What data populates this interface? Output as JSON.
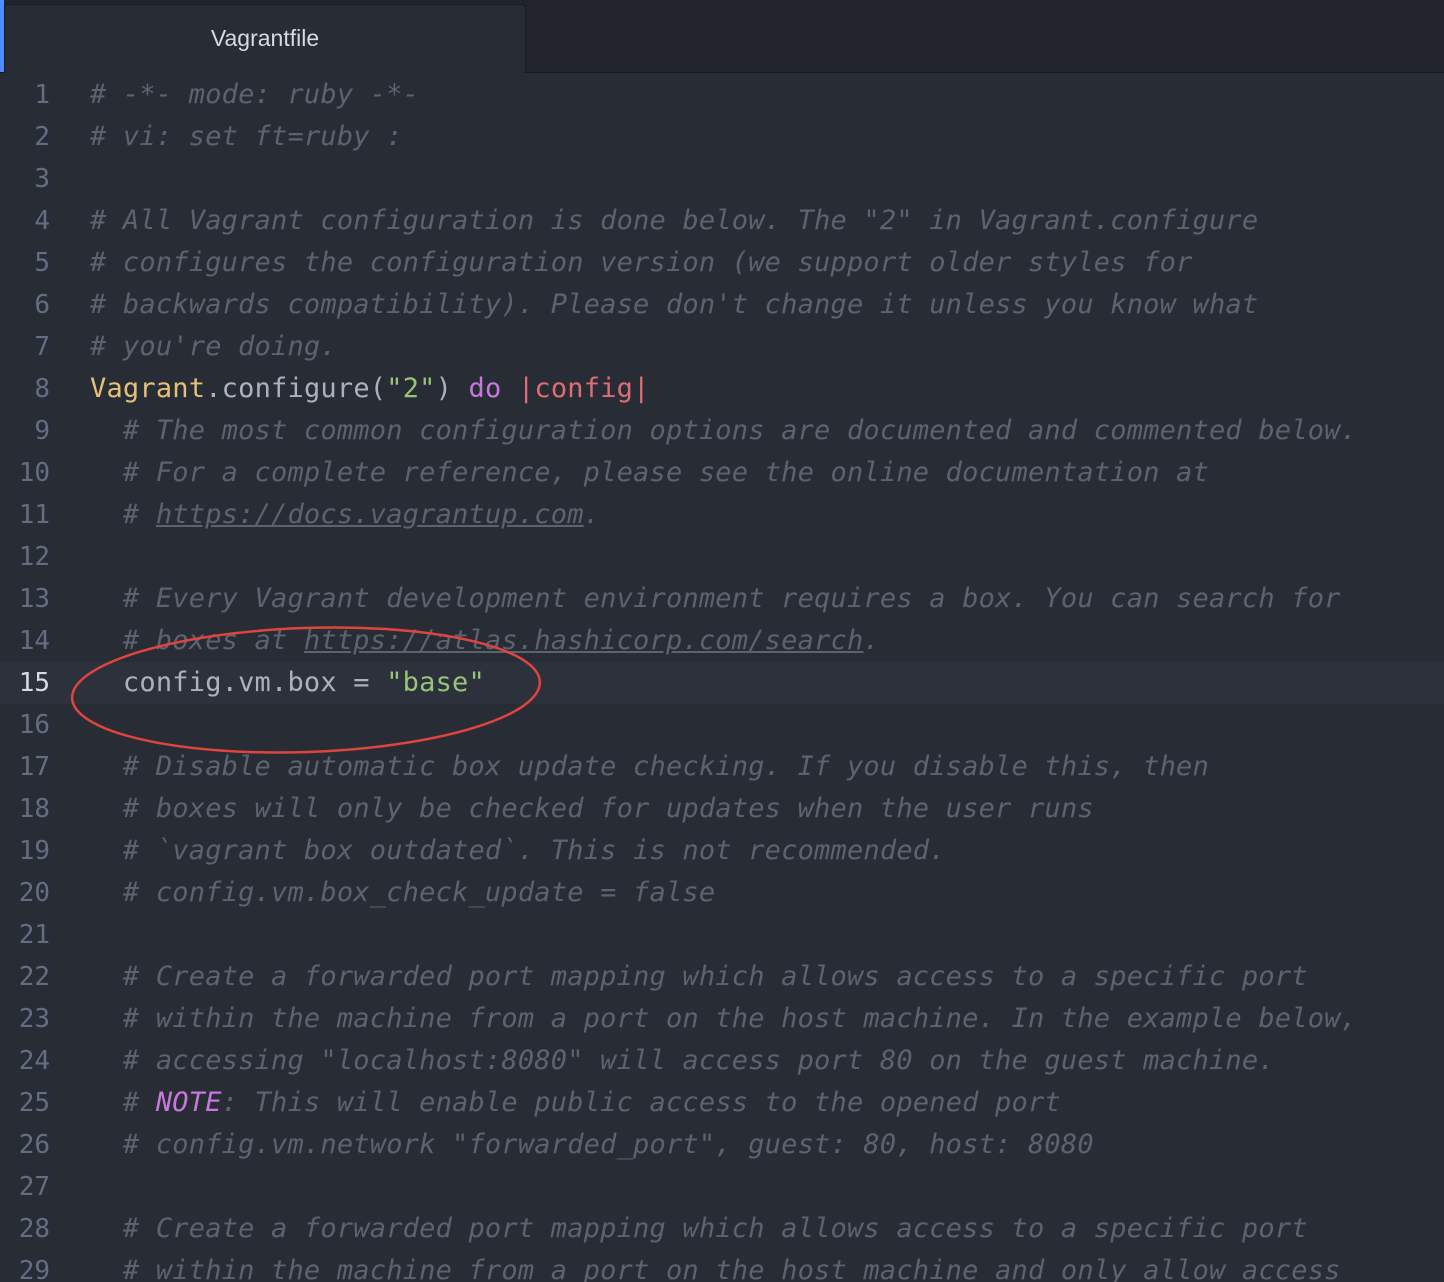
{
  "tab": {
    "title": "Vagrantfile"
  },
  "editor": {
    "cursor_line": "15",
    "lines": [
      {
        "n": "1",
        "comment": "# -*- mode: ruby -*-"
      },
      {
        "n": "2",
        "comment": "# vi: set ft=ruby :"
      },
      {
        "n": "3"
      },
      {
        "n": "4",
        "comment": "# All Vagrant configuration is done below. The \"2\" in Vagrant.configure"
      },
      {
        "n": "5",
        "comment": "# configures the configuration version (we support older styles for"
      },
      {
        "n": "6",
        "comment": "# backwards compatibility). Please don't change it unless you know what"
      },
      {
        "n": "7",
        "comment": "# you're doing."
      },
      {
        "n": "8",
        "cls": "Vagrant",
        "dot": ".",
        "method": "configure(",
        "str": "\"2\"",
        "close": ")",
        "space": " ",
        "kw": "do",
        "space2": " ",
        "var": "|config|"
      },
      {
        "n": "9",
        "comment": "  # The most common configuration options are documented and commented below."
      },
      {
        "n": "10",
        "comment": "  # For a complete reference, please see the online documentation at"
      },
      {
        "n": "11",
        "prefix": "  # ",
        "link": "https://docs.vagrantup.com",
        "suffix": "."
      },
      {
        "n": "12"
      },
      {
        "n": "13",
        "comment": "  # Every Vagrant development environment requires a box. You can search for"
      },
      {
        "n": "14",
        "prefix": "  # boxes at ",
        "link": "https://atlas.hashicorp.com/search",
        "suffix": "."
      },
      {
        "n": "15",
        "code": "  config.vm.box = ",
        "str": "\"base\""
      },
      {
        "n": "16"
      },
      {
        "n": "17",
        "comment": "  # Disable automatic box update checking. If you disable this, then"
      },
      {
        "n": "18",
        "comment": "  # boxes will only be checked for updates when the user runs"
      },
      {
        "n": "19",
        "comment": "  # `vagrant box outdated`. This is not recommended."
      },
      {
        "n": "20",
        "comment": "  # config.vm.box_check_update = false"
      },
      {
        "n": "21"
      },
      {
        "n": "22",
        "comment": "  # Create a forwarded port mapping which allows access to a specific port"
      },
      {
        "n": "23",
        "comment": "  # within the machine from a port on the host machine. In the example below,"
      },
      {
        "n": "24",
        "comment": "  # accessing \"localhost:8080\" will access port 80 on the guest machine."
      },
      {
        "n": "25",
        "prefix": "  # ",
        "note": "NOTE",
        "suffix": ": This will enable public access to the opened port"
      },
      {
        "n": "26",
        "comment": "  # config.vm.network \"forwarded_port\", guest: 80, host: 8080"
      },
      {
        "n": "27"
      },
      {
        "n": "28",
        "comment": "  # Create a forwarded port mapping which allows access to a specific port"
      },
      {
        "n": "29",
        "comment": "  # within the machine from a port on the host machine and only allow access"
      }
    ]
  },
  "annotation": {
    "color": "#e0443e"
  }
}
